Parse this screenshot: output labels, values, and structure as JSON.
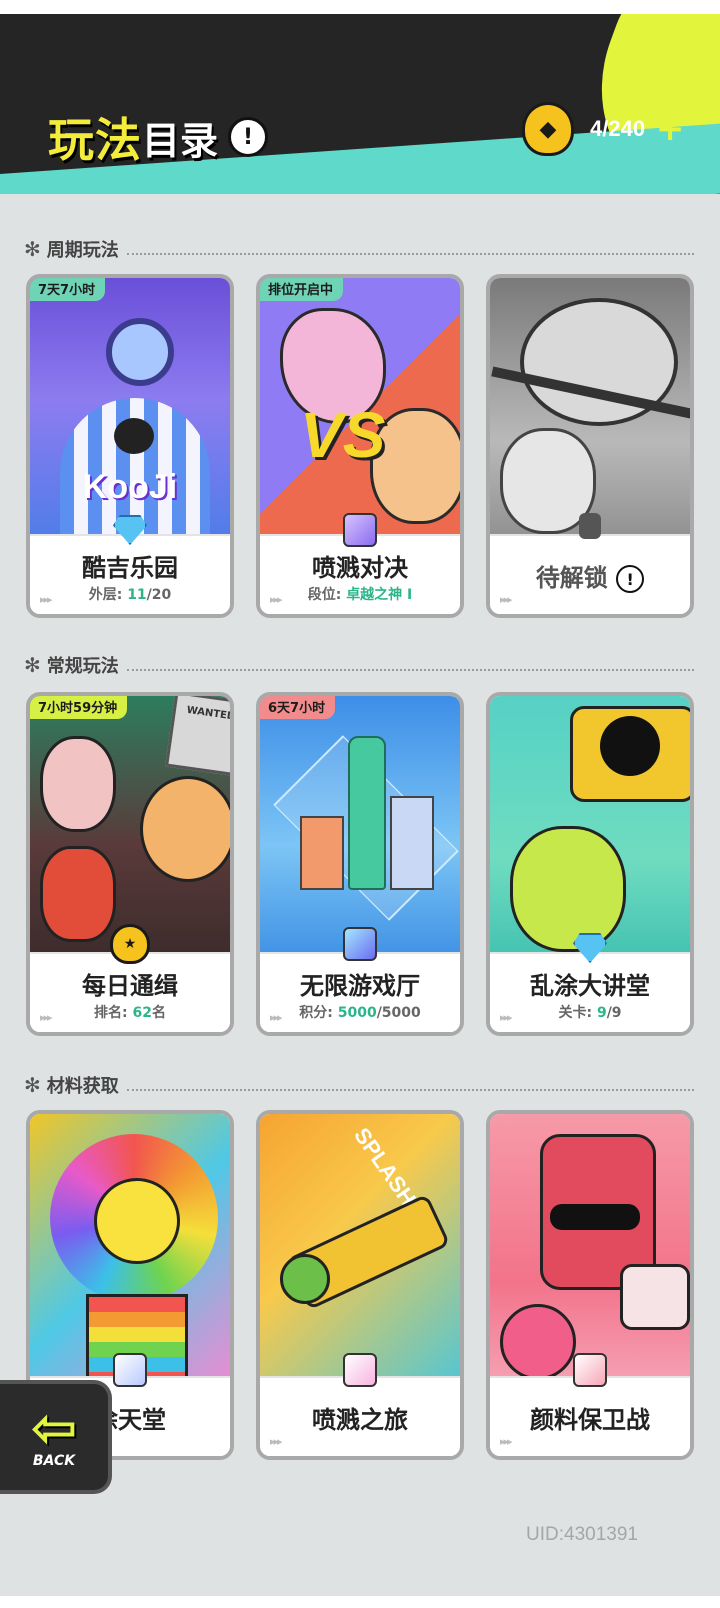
{
  "header": {
    "title_main": "玩法",
    "title_sub": "目录",
    "currency": "4/240",
    "plus": "+"
  },
  "sections": [
    {
      "label": "周期玩法"
    },
    {
      "label": "常规玩法"
    },
    {
      "label": "材料获取"
    }
  ],
  "cards": {
    "kooji": {
      "timer": "7天7小时",
      "art_text": "KooJi",
      "title": "酷吉乐园",
      "sub_prefix": "外层: ",
      "sub_value": "11",
      "sub_suffix": "/20"
    },
    "splash_duel": {
      "timer": "排位开启中",
      "art_text": "VS",
      "title": "喷溅对决",
      "sub_prefix": "段位: ",
      "sub_value": "卓越之神 I",
      "sub_suffix": ""
    },
    "locked": {
      "title": "待解锁"
    },
    "daily_wanted": {
      "timer": "7小时59分钟",
      "art_text": "WANTED",
      "title": "每日通缉",
      "sub_prefix": "排名: ",
      "sub_value": "62",
      "sub_suffix": "名"
    },
    "arcade": {
      "timer": "6天7小时",
      "title": "无限游戏厅",
      "sub_prefix": "积分: ",
      "sub_value": "5000",
      "sub_suffix": "/5000"
    },
    "lecture": {
      "title": "乱涂大讲堂",
      "sub_prefix": "关卡: ",
      "sub_value": "9",
      "sub_suffix": "/9"
    },
    "paint_heaven": {
      "title": "涂天堂"
    },
    "splash_journey": {
      "art_text": "SPLASH",
      "title": "喷溅之旅"
    },
    "pigment_defense": {
      "title": "颜料保卫战"
    }
  },
  "back": {
    "label": "BACK"
  },
  "uid": "UID:4301391",
  "colors": {
    "accent_yellow": "#e2f53c",
    "teal": "#5fd9c9",
    "highlight_green": "#2bb58a"
  }
}
